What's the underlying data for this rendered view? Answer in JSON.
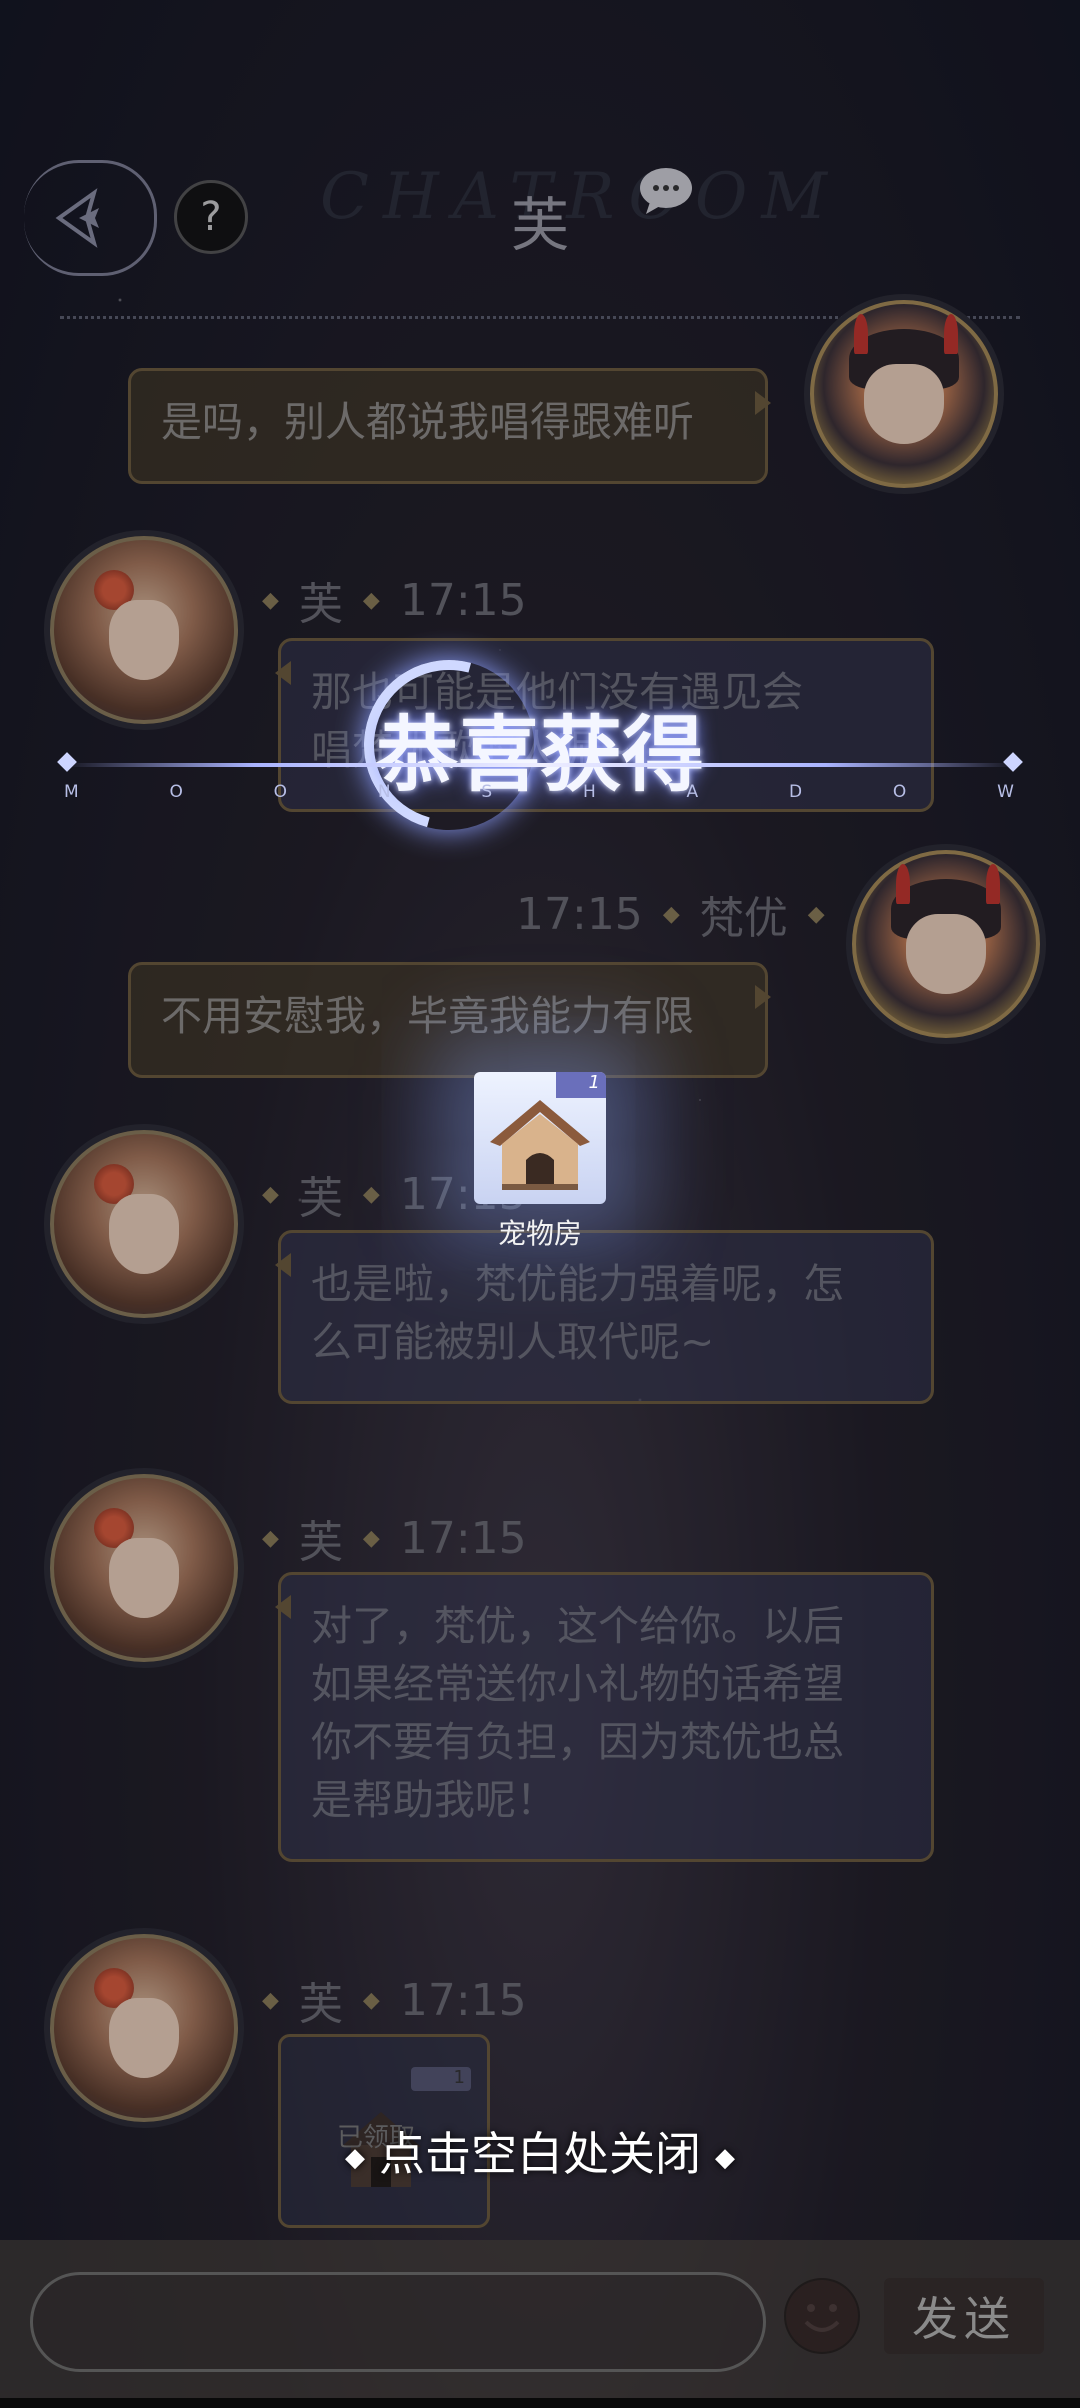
{
  "header": {
    "watermark": "CHATROOM",
    "title": "芙"
  },
  "messages": [
    {
      "side": "right",
      "name": "梵优",
      "time": "17:15",
      "text": "是吗，别人都说我唱得跟难听"
    },
    {
      "side": "left",
      "name": "芙",
      "time": "17:15",
      "lines": [
        "那也可能是他们没有遇见会",
        "唱梵优歌的人呢~"
      ]
    },
    {
      "side": "right",
      "name": "梵优",
      "time": "17:15",
      "text": "不用安慰我，毕竟我能力有限"
    },
    {
      "side": "left",
      "name": "芙",
      "time": "17:15",
      "lines": [
        "也是啦，梵优能力强着呢，怎",
        "么可能被别人取代呢~"
      ]
    },
    {
      "side": "left",
      "name": "芙",
      "time": "17:15",
      "lines": [
        "对了，梵优，这个给你。以后",
        "如果经常送你小礼物的话希望",
        "你不要有负担，因为梵优也总",
        "是帮助我呢！"
      ]
    },
    {
      "side": "left",
      "name": "芙",
      "time": "17:15",
      "gift_status": "已领取",
      "gift_count": "1"
    }
  ],
  "overlay": {
    "title": "恭喜获得",
    "subtitle_letters": [
      "M",
      "O",
      "O",
      "N",
      "S",
      "H",
      "A",
      "D",
      "O",
      "W"
    ],
    "reward_name": "宠物房",
    "reward_count": "1",
    "close_hint": "点击空白处关闭"
  },
  "input": {
    "placeholder": "",
    "send_label": "发送"
  },
  "icons": [
    "back-icon",
    "help-icon",
    "wechat-icon",
    "emoji-icon",
    "pet-house-icon"
  ]
}
